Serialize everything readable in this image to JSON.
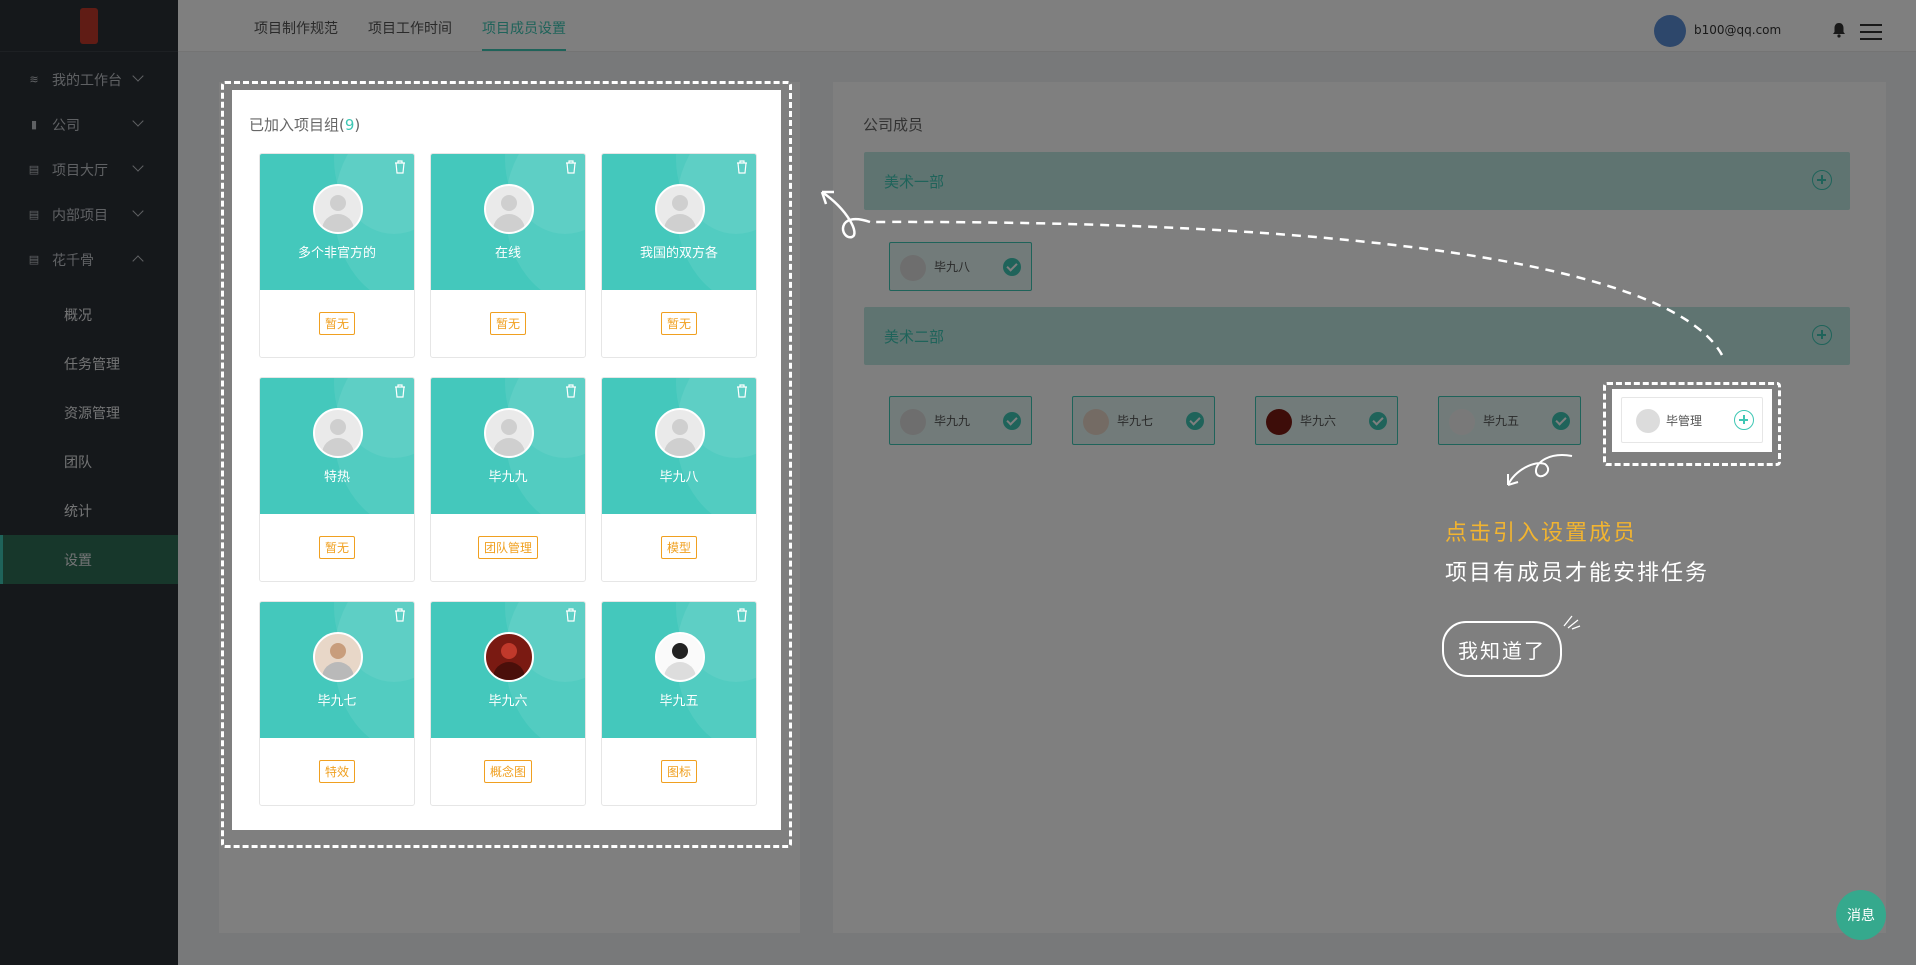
{
  "sidebar": {
    "items": [
      {
        "label": "我的工作台",
        "icon": "layers-icon"
      },
      {
        "label": "公司",
        "icon": "bar-chart-icon"
      },
      {
        "label": "项目大厅",
        "icon": "calendar-icon"
      },
      {
        "label": "内部项目",
        "icon": "calendar-icon"
      },
      {
        "label": "花千骨",
        "icon": "calendar-icon"
      }
    ],
    "subitems": [
      {
        "label": "概况"
      },
      {
        "label": "任务管理"
      },
      {
        "label": "资源管理"
      },
      {
        "label": "团队"
      },
      {
        "label": "统计"
      },
      {
        "label": "设置"
      }
    ]
  },
  "header": {
    "tabs": [
      {
        "label": "项目制作规范"
      },
      {
        "label": "项目工作时间"
      },
      {
        "label": "项目成员设置"
      }
    ],
    "user_email": "b100@qq.com"
  },
  "joined": {
    "title": "已加入项目组(",
    "count": "9",
    "close": ")",
    "members": [
      {
        "name": "多个非官方的",
        "tag": "暂无"
      },
      {
        "name": "在线",
        "tag": "暂无"
      },
      {
        "name": "我国的双方各",
        "tag": "暂无"
      },
      {
        "name": "特热",
        "tag": "暂无"
      },
      {
        "name": "毕九九",
        "tag": "团队管理"
      },
      {
        "name": "毕九八",
        "tag": "模型"
      },
      {
        "name": "毕九七",
        "tag": "特效"
      },
      {
        "name": "毕九六",
        "tag": "概念图"
      },
      {
        "name": "毕九五",
        "tag": "图标"
      }
    ]
  },
  "company": {
    "title": "公司成员",
    "groups": [
      {
        "name": "美术一部",
        "members": [
          {
            "name": "毕九八"
          }
        ]
      },
      {
        "name": "美术二部",
        "members": [
          {
            "name": "毕九九"
          },
          {
            "name": "毕九七"
          },
          {
            "name": "毕九六"
          },
          {
            "name": "毕九五"
          }
        ]
      }
    ],
    "highlight_member": {
      "name": "毕管理"
    }
  },
  "guide": {
    "line1": "点击引入设置成员",
    "line2": "项目有成员才能安排任务",
    "button": "我知道了"
  },
  "fab": {
    "label": "消息"
  },
  "colors": {
    "accent": "#3ec7b4",
    "tag": "#f0a020",
    "sidebar": "#2b3036",
    "guide_yellow": "#f2b430"
  }
}
